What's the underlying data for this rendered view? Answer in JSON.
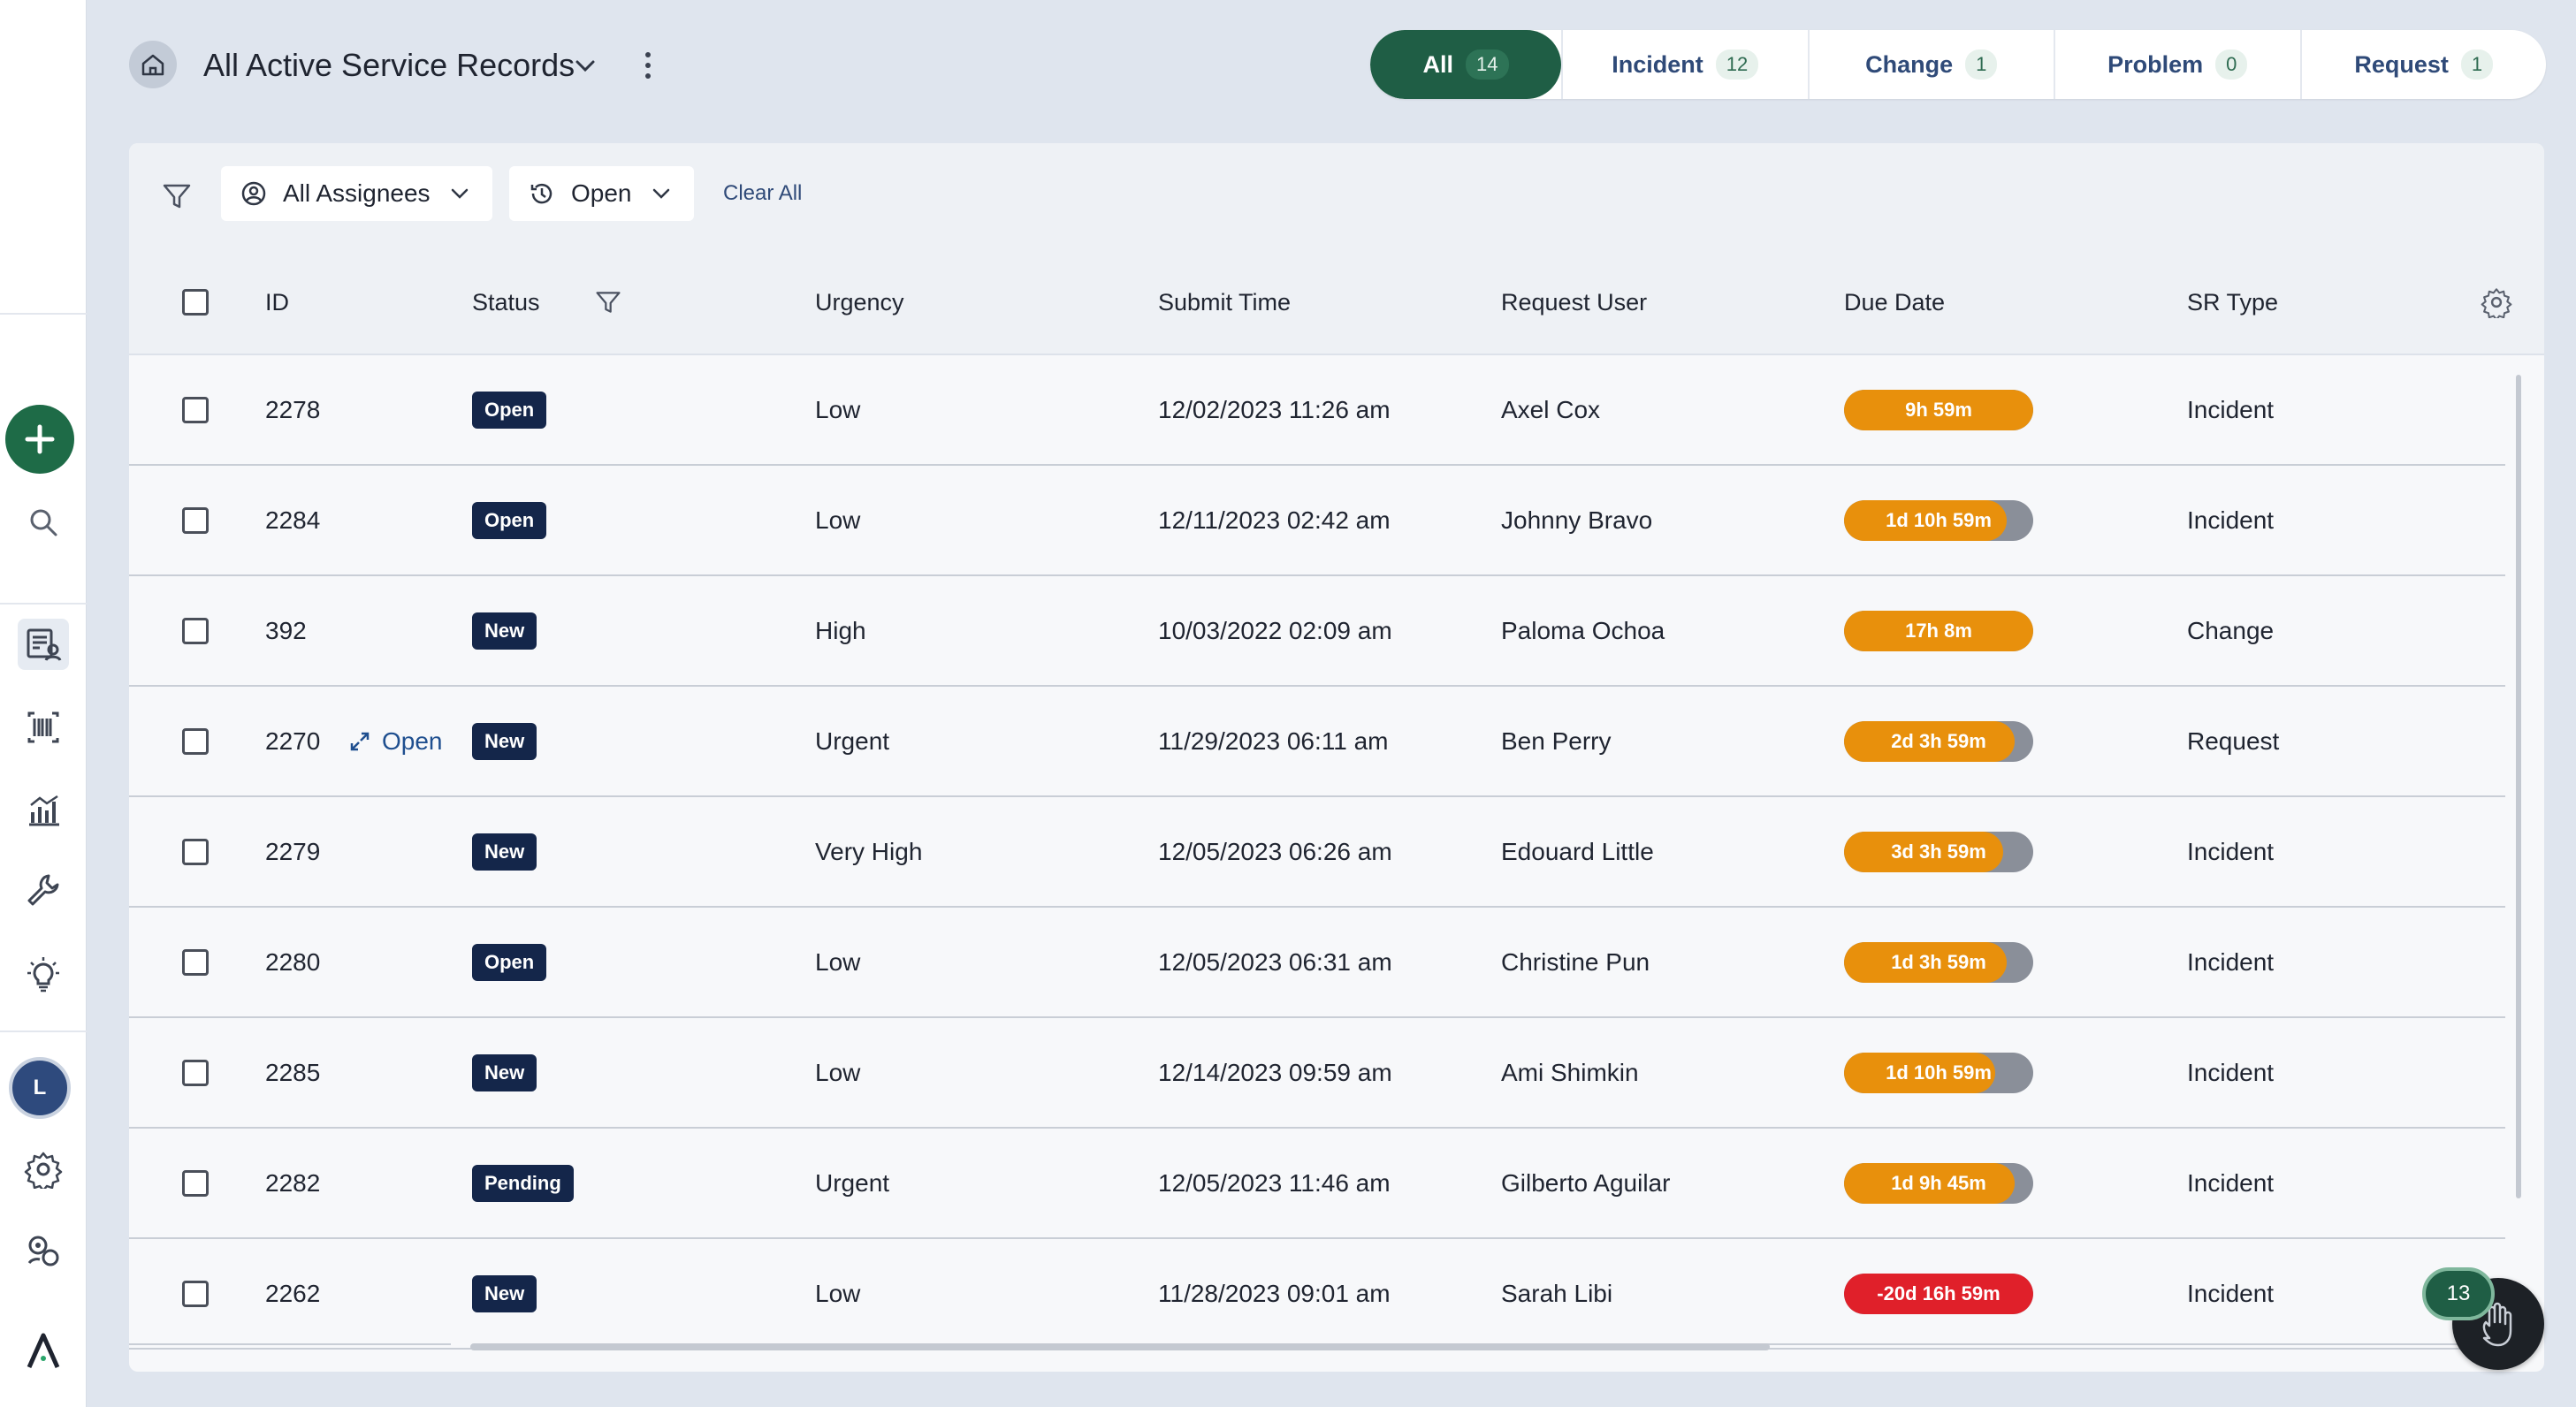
{
  "header": {
    "title": "All Active Service Records"
  },
  "tabs": [
    {
      "label": "All",
      "count": "14",
      "active": true
    },
    {
      "label": "Incident",
      "count": "12"
    },
    {
      "label": "Change",
      "count": "1"
    },
    {
      "label": "Problem",
      "count": "0"
    },
    {
      "label": "Request",
      "count": "1"
    }
  ],
  "filters": {
    "assignees": "All Assignees",
    "status": "Open",
    "clear_all": "Clear All"
  },
  "table": {
    "columns": [
      "ID",
      "Status",
      "Urgency",
      "Submit Time",
      "Request User",
      "Due Date",
      "SR Type"
    ],
    "hover_action": "Open",
    "rows": [
      {
        "id": "2278",
        "status": "Open",
        "urgency": "Low",
        "submit": "12/02/2023 11:26 am",
        "user": "Axel Cox",
        "due": "9h 59m",
        "due_progress": 1.0,
        "due_color": "#e8900c",
        "type": "Incident"
      },
      {
        "id": "2284",
        "status": "Open",
        "urgency": "Low",
        "submit": "12/11/2023 02:42 am",
        "user": "Johnny Bravo",
        "due": "1d 10h 59m",
        "due_progress": 0.86,
        "due_color": "#e8900c",
        "type": "Incident"
      },
      {
        "id": "392",
        "status": "New",
        "urgency": "High",
        "submit": "10/03/2022 02:09 am",
        "user": "Paloma Ochoa",
        "due": "17h 8m",
        "due_progress": 1.0,
        "due_color": "#e8900c",
        "type": "Change"
      },
      {
        "id": "2270",
        "status": "New",
        "urgency": "Urgent",
        "submit": "11/29/2023 06:11 am",
        "user": "Ben Perry",
        "due": "2d 3h 59m",
        "due_progress": 0.9,
        "due_color": "#e8900c",
        "type": "Request",
        "hovered": true
      },
      {
        "id": "2279",
        "status": "New",
        "urgency": "Very High",
        "submit": "12/05/2023 06:26 am",
        "user": "Edouard Little",
        "due": "3d 3h 59m",
        "due_progress": 0.84,
        "due_color": "#e8900c",
        "type": "Incident"
      },
      {
        "id": "2280",
        "status": "Open",
        "urgency": "Low",
        "submit": "12/05/2023 06:31 am",
        "user": "Christine Pun",
        "due": "1d 3h 59m",
        "due_progress": 0.86,
        "due_color": "#e8900c",
        "type": "Incident"
      },
      {
        "id": "2285",
        "status": "New",
        "urgency": "Low",
        "submit": "12/14/2023 09:59 am",
        "user": "Ami Shimkin",
        "due": "1d 10h 59m",
        "due_progress": 0.8,
        "due_color": "#e8900c",
        "type": "Incident"
      },
      {
        "id": "2282",
        "status": "Pending",
        "urgency": "Urgent",
        "submit": "12/05/2023 11:46 am",
        "user": "Gilberto Aguilar",
        "due": "1d 9h 45m",
        "due_progress": 0.9,
        "due_color": "#e8900c",
        "type": "Incident"
      },
      {
        "id": "2262",
        "status": "New",
        "urgency": "Low",
        "submit": "11/28/2023 09:01 am",
        "user": "Sarah Libi",
        "due": "-20d 16h 59m",
        "due_progress": 1.0,
        "due_color": "#e0202a",
        "type": "Incident"
      }
    ]
  },
  "fab": {
    "count": "13"
  },
  "sidebar": {
    "avatar_initial": "L"
  },
  "colors": {
    "brand": "#1f5e45",
    "badge": "#14264a",
    "due_warning": "#e8900c",
    "due_overdue": "#e0202a"
  }
}
